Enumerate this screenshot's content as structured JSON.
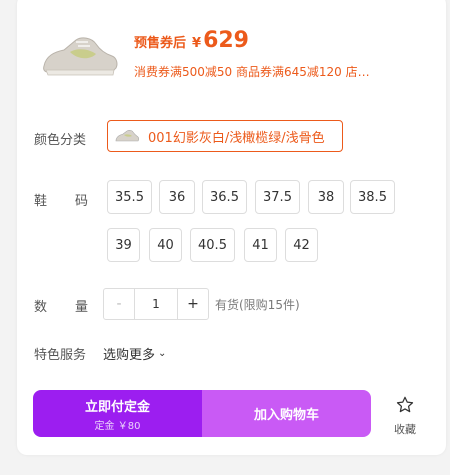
{
  "product": {
    "price_label": "预售券后",
    "currency": "¥",
    "price": "629",
    "coupon_text": "消费券满500减50 商品券满645减120 店…"
  },
  "color": {
    "label": "颜色分类",
    "selected": "001幻影灰白/浅橄榄绿/浅骨色"
  },
  "size": {
    "label": "鞋码",
    "options": [
      "35.5",
      "36",
      "36.5",
      "37.5",
      "38",
      "38.5",
      "39",
      "40",
      "40.5",
      "41",
      "42"
    ]
  },
  "quantity": {
    "label": "数量",
    "minus": "-",
    "value": "1",
    "plus": "+",
    "stock": "有货(限购15件)"
  },
  "service": {
    "label": "特色服务",
    "value": "选购更多"
  },
  "actions": {
    "deposit_main": "立即付定金",
    "deposit_sub": "定金 ￥80",
    "cart": "加入购物车",
    "favorite": "收藏"
  },
  "colors": {
    "accent": "#ec5a1b",
    "purple_dark": "#9c1ef0",
    "purple_light": "#c95af5"
  }
}
